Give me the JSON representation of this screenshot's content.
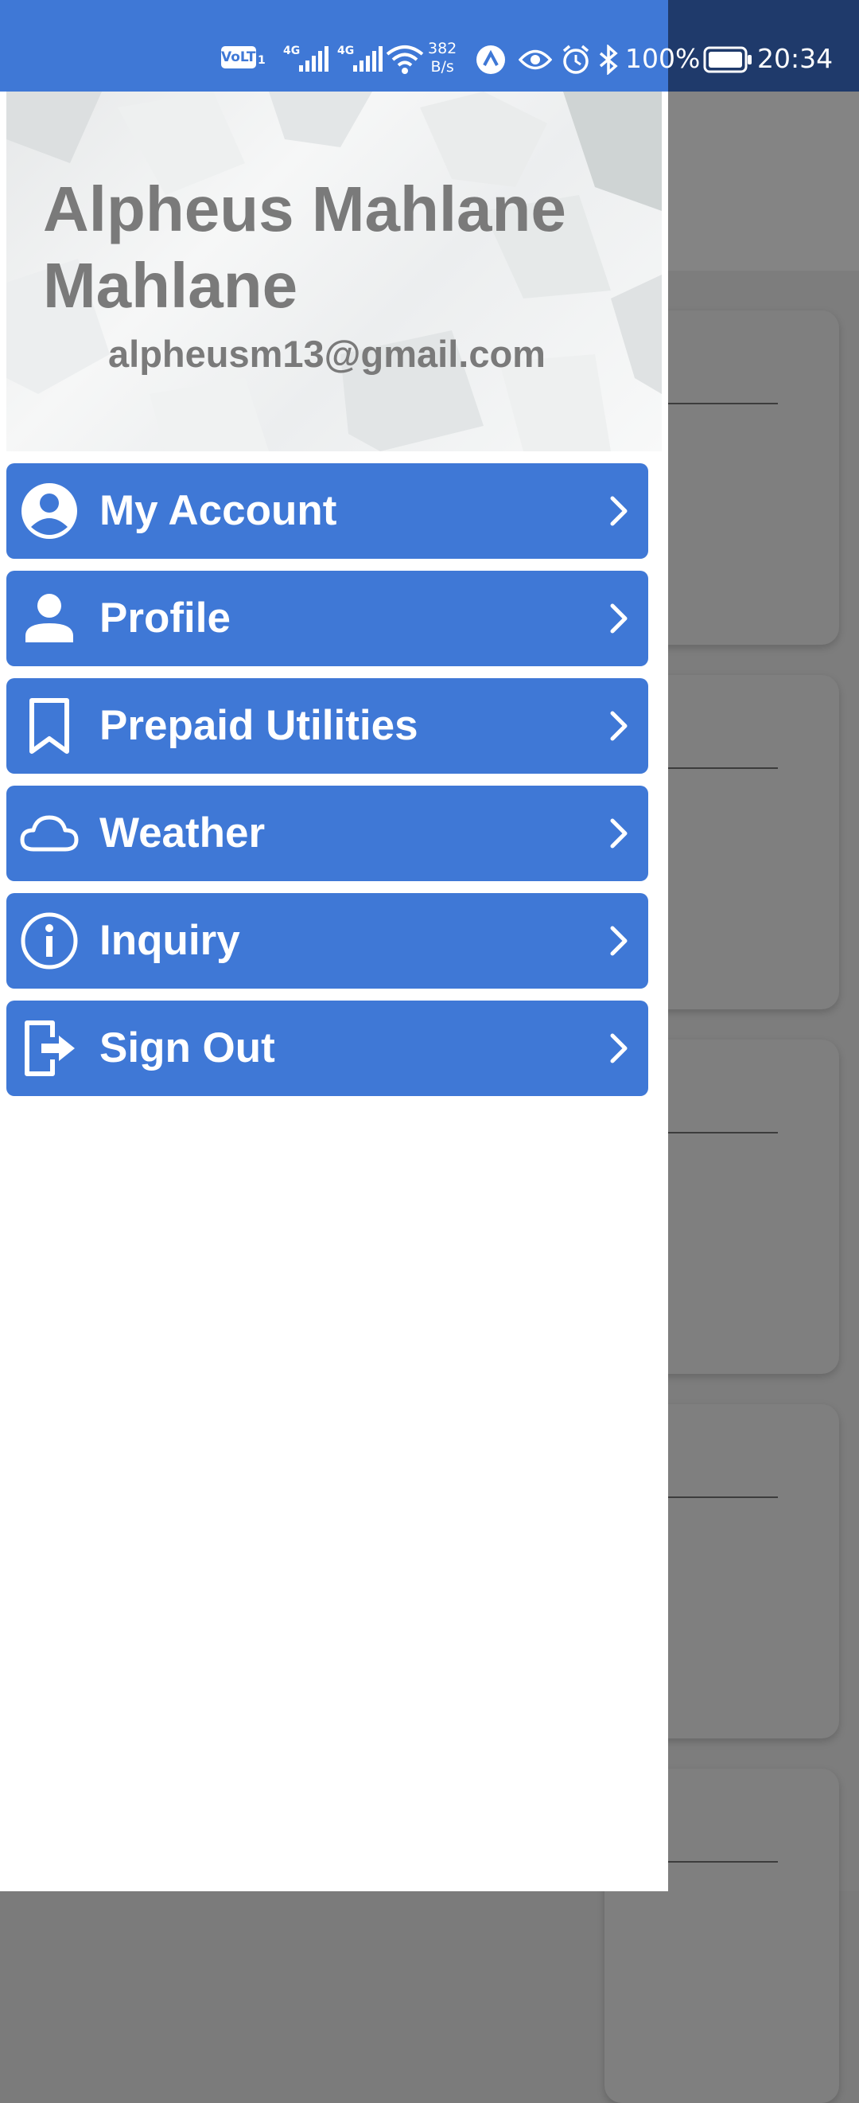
{
  "status_bar": {
    "volte_label": "VoLTE",
    "sim1_network": "4G",
    "sim2_network": "4G",
    "speed_value": "382",
    "speed_unit": "B/s",
    "battery_percent": "100%",
    "time": "20:34"
  },
  "drawer": {
    "user_name": "Alpheus Mahlane Mahlane",
    "user_email": "alpheusm13@gmail.com",
    "menu_items": [
      {
        "label": "My Account",
        "icon": "account-circle-icon"
      },
      {
        "label": "Profile",
        "icon": "person-icon"
      },
      {
        "label": "Prepaid Utilities",
        "icon": "bookmark-icon"
      },
      {
        "label": "Weather",
        "icon": "cloud-icon"
      },
      {
        "label": "Inquiry",
        "icon": "info-icon"
      },
      {
        "label": "Sign Out",
        "icon": "exit-icon"
      }
    ]
  },
  "colors": {
    "accent": "#3f78d6",
    "status_bar_dim": "#1f3a6b",
    "scrim": "#7b7b7b",
    "header_text": "#7a7a7a"
  }
}
